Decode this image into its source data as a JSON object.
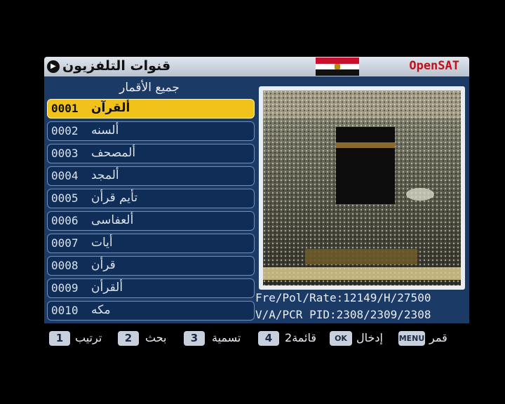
{
  "header": {
    "title": "قنوات التلفزيون",
    "brand": "OpenSAT",
    "flag_colors": [
      "#c8102e",
      "#ffffff",
      "#111111"
    ],
    "back_icon": "circle-arrow-icon"
  },
  "list": {
    "header": "جميع الأقمار",
    "channels": [
      {
        "num": "0001",
        "name": "ألقرآن",
        "selected": true
      },
      {
        "num": "0002",
        "name": "ألسنه"
      },
      {
        "num": "0003",
        "name": "ألمصحف"
      },
      {
        "num": "0004",
        "name": "ألمجد"
      },
      {
        "num": "0005",
        "name": "تأيم قرأن"
      },
      {
        "num": "0006",
        "name": "ألعفاسى"
      },
      {
        "num": "0007",
        "name": "أيات"
      },
      {
        "num": "0008",
        "name": "قرأن"
      },
      {
        "num": "0009",
        "name": "ألقرأن"
      },
      {
        "num": "0010",
        "name": "مكه"
      }
    ]
  },
  "info": {
    "freq_line": "Fre/Pol/Rate:12149/H/27500",
    "pid_line": "V/A/PCR PID:2308/2309/2308"
  },
  "keys": [
    {
      "key": "1",
      "label": "ترتيب"
    },
    {
      "key": "2",
      "label": "بحث"
    },
    {
      "key": "3",
      "label": "تسمية"
    },
    {
      "key": "4",
      "label": "قائمة2"
    },
    {
      "key": "OK",
      "label": "إدخال"
    },
    {
      "key": "MENU",
      "label": "قمر"
    }
  ],
  "colors": {
    "panel": "#1c3a66",
    "selected": "#f1c21a",
    "brand": "#c0121a"
  }
}
